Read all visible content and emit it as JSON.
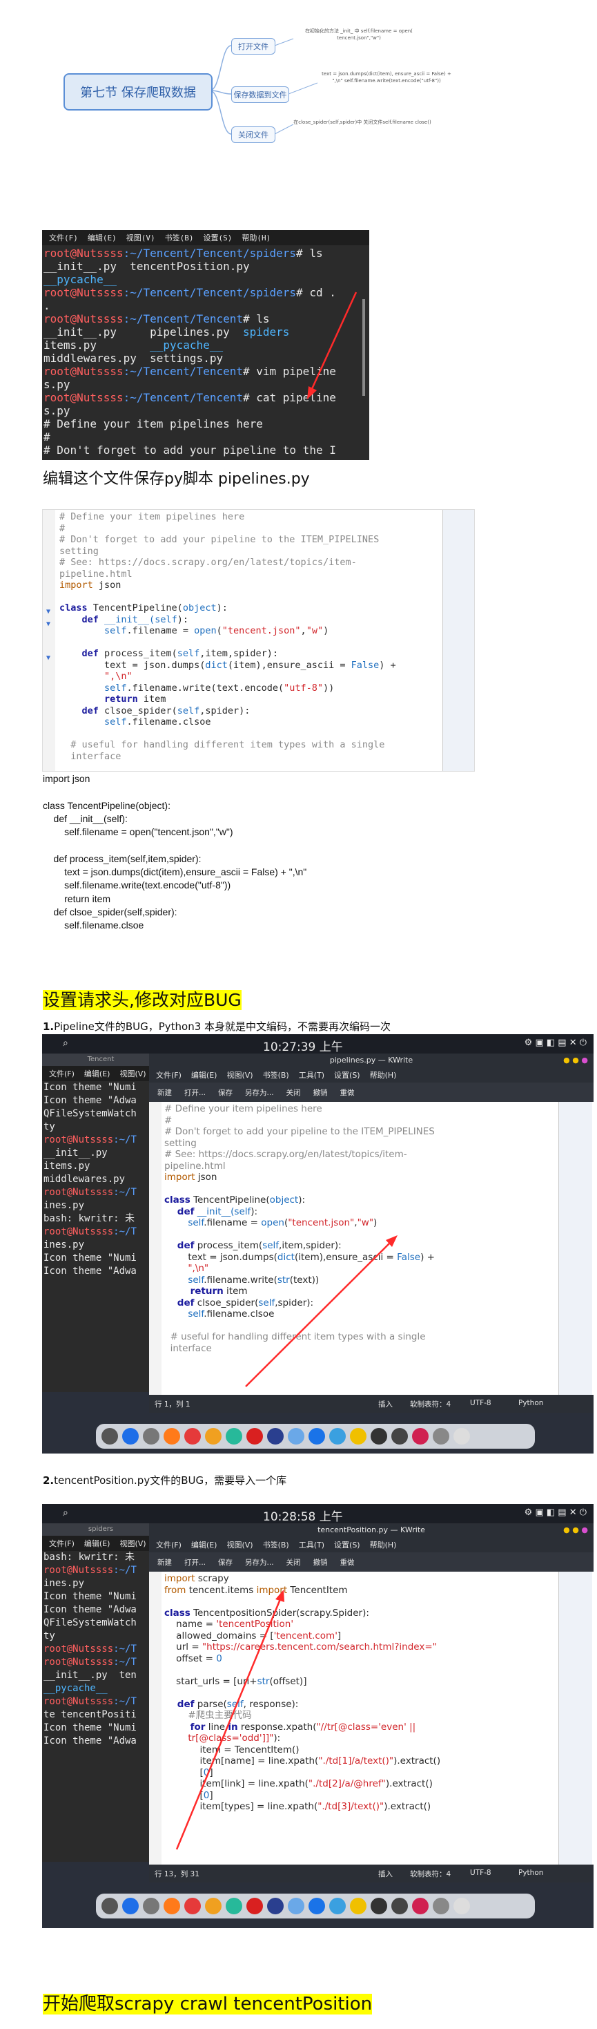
{
  "mindmap": {
    "root": "第七节 保存爬取数据",
    "branches": [
      {
        "label": "打开文件",
        "note": "在初始化的方法 _init_ 中 self.filename = open( tencent.json\",\"w\")"
      },
      {
        "label": "保存数据到文件",
        "note": "text = json.dumps(dict(item), ensure_ascii = False) + \",\\n\" self.filename.write(text.encode(\"utf-8\"))"
      },
      {
        "label": "关闭文件",
        "note": "在close_spider(self,spider)中 关闭文件self.filename close()"
      }
    ]
  },
  "terminal1": {
    "menu": [
      "文件(F)",
      "编辑(E)",
      "视图(V)",
      "书签(B)",
      "设置(S)",
      "帮助(H)"
    ],
    "lines": [
      [
        {
          "t": "root@Nutssss",
          "c": "red"
        },
        {
          "t": ":~/Tencent/Tencent/spiders",
          "c": "blue"
        },
        {
          "t": "# ls",
          "c": "white"
        }
      ],
      [
        {
          "t": "__init__.py  tencentPosition.py",
          "c": "white"
        }
      ],
      [
        {
          "t": "__pycache__",
          "c": "cyan"
        }
      ],
      [
        {
          "t": "root@Nutssss",
          "c": "red"
        },
        {
          "t": ":~/Tencent/Tencent/spiders",
          "c": "blue"
        },
        {
          "t": "# cd .",
          "c": "white"
        }
      ],
      [
        {
          "t": ".",
          "c": "white"
        }
      ],
      [
        {
          "t": "root@Nutssss",
          "c": "red"
        },
        {
          "t": ":~/Tencent/Tencent",
          "c": "blue"
        },
        {
          "t": "# ls",
          "c": "white"
        }
      ],
      [
        {
          "t": "__init__.py     pipelines.py  ",
          "c": "white"
        },
        {
          "t": "spiders",
          "c": "cyan"
        }
      ],
      [
        {
          "t": "items.py        ",
          "c": "white"
        },
        {
          "t": "__pycache__",
          "c": "cyan"
        }
      ],
      [
        {
          "t": "middlewares.py  settings.py",
          "c": "white"
        }
      ],
      [
        {
          "t": "root@Nutssss",
          "c": "red"
        },
        {
          "t": ":~/Tencent/Tencent",
          "c": "blue"
        },
        {
          "t": "# vim pipeline",
          "c": "white"
        }
      ],
      [
        {
          "t": "s.py",
          "c": "white"
        }
      ],
      [
        {
          "t": "root@Nutssss",
          "c": "red"
        },
        {
          "t": ":~/Tencent/Tencent",
          "c": "blue"
        },
        {
          "t": "# cat pipeline",
          "c": "white"
        }
      ],
      [
        {
          "t": "s.py",
          "c": "white"
        }
      ],
      [
        {
          "t": "# Define your item pipelines here",
          "c": "white"
        }
      ],
      [
        {
          "t": "#",
          "c": "white"
        }
      ],
      [
        {
          "t": "# Don't forget to add your pipeline to the I",
          "c": "white"
        }
      ]
    ]
  },
  "caption1": "编辑这个文件保存py脚本  pipelines.py",
  "code1": [
    [
      {
        "t": "# Define your item pipelines here",
        "c": "cm"
      }
    ],
    [
      {
        "t": "#",
        "c": "cm"
      }
    ],
    [
      {
        "t": "# Don't forget to add your pipeline to the ITEM_PIPELINES",
        "c": "cm"
      }
    ],
    [
      {
        "t": "setting",
        "c": "cm"
      }
    ],
    [
      {
        "t": "# See: https://docs.scrapy.org/en/latest/topics/item-",
        "c": "cm"
      }
    ],
    [
      {
        "t": "pipeline.html",
        "c": "cm"
      }
    ],
    [
      {
        "t": "import",
        "c": "imp"
      },
      {
        "t": " json",
        "c": "fn"
      }
    ],
    [
      {
        "t": "",
        "c": "fn"
      }
    ],
    [
      {
        "t": "class",
        "c": "k"
      },
      {
        "t": " TencentPipeline(",
        "c": "fn"
      },
      {
        "t": "object",
        "c": "b"
      },
      {
        "t": "):",
        "c": "fn"
      }
    ],
    [
      {
        "t": "    def",
        "c": "k"
      },
      {
        "t": " __init__(",
        "c": "b"
      },
      {
        "t": "self",
        "c": "b"
      },
      {
        "t": "):",
        "c": "fn"
      }
    ],
    [
      {
        "t": "        self",
        "c": "b"
      },
      {
        "t": ".filename = ",
        "c": "fn"
      },
      {
        "t": "open",
        "c": "b"
      },
      {
        "t": "(",
        "c": "fn"
      },
      {
        "t": "\"tencent.json\"",
        "c": "s"
      },
      {
        "t": ",",
        "c": "fn"
      },
      {
        "t": "\"w\"",
        "c": "s"
      },
      {
        "t": ")",
        "c": "fn"
      }
    ],
    [
      {
        "t": "",
        "c": "fn"
      }
    ],
    [
      {
        "t": "    def",
        "c": "k"
      },
      {
        "t": " process_item(",
        "c": "fn"
      },
      {
        "t": "self",
        "c": "b"
      },
      {
        "t": ",item,spider):",
        "c": "fn"
      }
    ],
    [
      {
        "t": "        text = json.dumps(",
        "c": "fn"
      },
      {
        "t": "dict",
        "c": "b"
      },
      {
        "t": "(item),ensure_ascii = ",
        "c": "fn"
      },
      {
        "t": "False",
        "c": "b"
      },
      {
        "t": ") +",
        "c": "fn"
      }
    ],
    [
      {
        "t": "        \",\\n\"",
        "c": "s"
      }
    ],
    [
      {
        "t": "        self",
        "c": "b"
      },
      {
        "t": ".filename.write(text.encode(",
        "c": "fn"
      },
      {
        "t": "\"utf-8\"",
        "c": "s"
      },
      {
        "t": "))",
        "c": "fn"
      }
    ],
    [
      {
        "t": "        return",
        "c": "k"
      },
      {
        "t": " item",
        "c": "fn"
      }
    ],
    [
      {
        "t": "    def",
        "c": "k"
      },
      {
        "t": " clsoe_spider(",
        "c": "fn"
      },
      {
        "t": "self",
        "c": "b"
      },
      {
        "t": ",spider):",
        "c": "fn"
      }
    ],
    [
      {
        "t": "        self",
        "c": "b"
      },
      {
        "t": ".filename.clsoe",
        "c": "fn"
      }
    ],
    [
      {
        "t": "",
        "c": "fn"
      }
    ],
    [
      {
        "t": "  # useful for handling different item types with a single",
        "c": "cm"
      }
    ],
    [
      {
        "t": "  interface",
        "c": "cm"
      }
    ]
  ],
  "plaincode": "import json\n\nclass TencentPipeline(object):\n    def __init__(self):\n        self.filename = open(\"tencent.json\",\"w\")\n\n    def process_item(self,item,spider):\n        text = json.dumps(dict(item),ensure_ascii = False) + \",\\n\"\n        self.filename.write(text.encode(\"utf-8\"))\n        return item\n    def clsoe_spider(self,spider):\n        self.filename.clsoe",
  "heading1": "设置请求头,修改对应BUG",
  "step1": {
    "num": "1.",
    "text": "Pipeline文件的BUG，Python3 本身就是中文编码，不需要再次编码一次"
  },
  "shot1": {
    "clock": "10:27:39 上午",
    "title": "pipelines.py — KWrite",
    "tab": "Tencent",
    "term_menu": [
      "文件(F)",
      "编辑(E)",
      "视图(V)"
    ],
    "kw_menu": [
      "文件(F)",
      "编辑(E)",
      "视图(V)",
      "书签(B)",
      "工具(T)",
      "设置(S)",
      "帮助(H)"
    ],
    "toolbar": [
      "新建",
      "打开...",
      "保存",
      "另存为...",
      "关闭",
      "撤销",
      "重做"
    ],
    "term_lines": [
      "Icon theme \"Numi",
      "Icon theme \"Adwa",
      "QFileSystemWatch",
      "ty",
      "root@Nutssss:~/T",
      "__init__.py",
      "items.py",
      "middlewares.py",
      "root@Nutssss:~/T",
      "ines.py",
      "bash: kwritr: 未",
      "root@Nutssss:~/T",
      "ines.py",
      "Icon theme \"Numi",
      "Icon theme \"Adwa"
    ],
    "status_pos": "行 1，列 1",
    "status_insert": "插入",
    "status_indent": "软制表符：4",
    "status_enc": "UTF-8",
    "status_lang": "Python"
  },
  "code2": [
    [
      {
        "t": "# Define your item pipelines here",
        "c": "cm"
      }
    ],
    [
      {
        "t": "#",
        "c": "cm"
      }
    ],
    [
      {
        "t": "# Don't forget to add your pipeline to the ITEM_PIPELINES",
        "c": "cm"
      }
    ],
    [
      {
        "t": "setting",
        "c": "cm"
      }
    ],
    [
      {
        "t": "# See: https://docs.scrapy.org/en/latest/topics/item-",
        "c": "cm"
      }
    ],
    [
      {
        "t": "pipeline.html",
        "c": "cm"
      }
    ],
    [
      {
        "t": "import",
        "c": "imp"
      },
      {
        "t": " json",
        "c": "fn"
      }
    ],
    [
      {
        "t": "",
        "c": "fn"
      }
    ],
    [
      {
        "t": "class",
        "c": "k"
      },
      {
        "t": " TencentPipeline(",
        "c": "fn"
      },
      {
        "t": "object",
        "c": "b"
      },
      {
        "t": "):",
        "c": "fn"
      }
    ],
    [
      {
        "t": "    def",
        "c": "k"
      },
      {
        "t": " __init__(",
        "c": "b"
      },
      {
        "t": "self",
        "c": "b"
      },
      {
        "t": "):",
        "c": "fn"
      }
    ],
    [
      {
        "t": "        self",
        "c": "b"
      },
      {
        "t": ".filename = ",
        "c": "fn"
      },
      {
        "t": "open",
        "c": "b"
      },
      {
        "t": "(",
        "c": "fn"
      },
      {
        "t": "\"tencent.json\"",
        "c": "s"
      },
      {
        "t": ",",
        "c": "fn"
      },
      {
        "t": "\"w\"",
        "c": "s"
      },
      {
        "t": ")",
        "c": "fn"
      }
    ],
    [
      {
        "t": "",
        "c": "fn"
      }
    ],
    [
      {
        "t": "    def",
        "c": "k"
      },
      {
        "t": " process_item(",
        "c": "fn"
      },
      {
        "t": "self",
        "c": "b"
      },
      {
        "t": ",item,spider):",
        "c": "fn"
      }
    ],
    [
      {
        "t": "        text = json.dumps(",
        "c": "fn"
      },
      {
        "t": "dict",
        "c": "b"
      },
      {
        "t": "(item),ensure_ascii = ",
        "c": "fn"
      },
      {
        "t": "False",
        "c": "b"
      },
      {
        "t": ") +",
        "c": "fn"
      }
    ],
    [
      {
        "t": "        \",\\n\"",
        "c": "s"
      }
    ],
    [
      {
        "t": "        self",
        "c": "b"
      },
      {
        "t": ".filename.write(",
        "c": "fn"
      },
      {
        "t": "str",
        "c": "b"
      },
      {
        "t": "(text))",
        "c": "fn"
      }
    ],
    [
      {
        "t": "        return",
        "c": "k"
      },
      {
        "t": " item",
        "c": "fn"
      }
    ],
    [
      {
        "t": "    def",
        "c": "k"
      },
      {
        "t": " clsoe_spider(",
        "c": "fn"
      },
      {
        "t": "self",
        "c": "b"
      },
      {
        "t": ",spider):",
        "c": "fn"
      }
    ],
    [
      {
        "t": "        self",
        "c": "b"
      },
      {
        "t": ".filename.clsoe",
        "c": "fn"
      }
    ],
    [
      {
        "t": "",
        "c": "fn"
      }
    ],
    [
      {
        "t": "  # useful for handling different item types with a single",
        "c": "cm"
      }
    ],
    [
      {
        "t": "  interface",
        "c": "cm"
      }
    ]
  ],
  "step2": {
    "num": "2.",
    "text": "tencentPosition.py文件的BUG，需要导入一个库"
  },
  "shot2": {
    "clock": "10:28:58 上午",
    "title": "tencentPosition.py — KWrite",
    "tab": "spiders",
    "term_menu": [
      "文件(F)",
      "编辑(E)",
      "视图(V)"
    ],
    "kw_menu": [
      "文件(F)",
      "编辑(E)",
      "视图(V)",
      "书签(B)",
      "工具(T)",
      "设置(S)",
      "帮助(H)"
    ],
    "toolbar": [
      "新建",
      "打开...",
      "保存",
      "另存为...",
      "关闭",
      "撤销",
      "重做"
    ],
    "term_lines": [
      "bash: kwritr: 未",
      "root@Nutssss:~/T",
      "ines.py",
      "Icon theme \"Numi",
      "Icon theme \"Adwa",
      "QFileSystemWatch",
      "ty",
      "root@Nutssss:~/T",
      "root@Nutssss:~/T",
      "__init__.py  ten",
      "__pycache__",
      "root@Nutssss:~/T",
      "te tencentPositi",
      "Icon theme \"Numi",
      "Icon theme \"Adwa"
    ],
    "status_pos": "行 13，列 31",
    "status_insert": "插入",
    "status_indent": "软制表符：4",
    "status_enc": "UTF-8",
    "status_lang": "Python"
  },
  "code3": [
    [
      {
        "t": "import",
        "c": "imp"
      },
      {
        "t": " scrapy",
        "c": "fn"
      }
    ],
    [
      {
        "t": "from",
        "c": "imp"
      },
      {
        "t": " tencent.items ",
        "c": "fn"
      },
      {
        "t": "import",
        "c": "imp"
      },
      {
        "t": " TencentItem",
        "c": "fn"
      }
    ],
    [
      {
        "t": "",
        "c": "fn"
      }
    ],
    [
      {
        "t": "class",
        "c": "k"
      },
      {
        "t": " TencentpositionSpider(scrapy.Spider):",
        "c": "fn"
      }
    ],
    [
      {
        "t": "    name = ",
        "c": "fn"
      },
      {
        "t": "'tencentPosition'",
        "c": "s"
      }
    ],
    [
      {
        "t": "    allowed_domains = [",
        "c": "fn"
      },
      {
        "t": "'tencent.com'",
        "c": "s"
      },
      {
        "t": "]",
        "c": "fn"
      }
    ],
    [
      {
        "t": "    url = ",
        "c": "fn"
      },
      {
        "t": "\"https://careers.tencent.com/search.html?index=\"",
        "c": "s"
      }
    ],
    [
      {
        "t": "    offset = ",
        "c": "fn"
      },
      {
        "t": "0",
        "c": "b"
      }
    ],
    [
      {
        "t": "",
        "c": "fn"
      }
    ],
    [
      {
        "t": "    start_urls = [url+",
        "c": "fn"
      },
      {
        "t": "str",
        "c": "b"
      },
      {
        "t": "(offset)]",
        "c": "fn"
      }
    ],
    [
      {
        "t": "",
        "c": "fn"
      }
    ],
    [
      {
        "t": "    def",
        "c": "k"
      },
      {
        "t": " parse(",
        "c": "fn"
      },
      {
        "t": "self",
        "c": "b"
      },
      {
        "t": ", response):",
        "c": "fn"
      }
    ],
    [
      {
        "t": "        #爬虫主要代码",
        "c": "cm"
      }
    ],
    [
      {
        "t": "        for",
        "c": "k"
      },
      {
        "t": " line ",
        "c": "fn"
      },
      {
        "t": "in",
        "c": "k"
      },
      {
        "t": " response.xpath(",
        "c": "fn"
      },
      {
        "t": "\"//tr[@class='even' ||",
        "c": "s"
      }
    ],
    [
      {
        "t": "        tr[@class='odd']]\"",
        "c": "s"
      },
      {
        "t": "):",
        "c": "fn"
      }
    ],
    [
      {
        "t": "            item = TencentItem()",
        "c": "fn"
      }
    ],
    [
      {
        "t": "            item[name] = line.xpath(",
        "c": "fn"
      },
      {
        "t": "\"./td[1]/a/text()\"",
        "c": "s"
      },
      {
        "t": ").extract()",
        "c": "fn"
      }
    ],
    [
      {
        "t": "            [",
        "c": "fn"
      },
      {
        "t": "0",
        "c": "b"
      },
      {
        "t": "]",
        "c": "fn"
      }
    ],
    [
      {
        "t": "            item[link] = line.xpath(",
        "c": "fn"
      },
      {
        "t": "\"./td[2]/a/@href\"",
        "c": "s"
      },
      {
        "t": ").extract()",
        "c": "fn"
      }
    ],
    [
      {
        "t": "            [",
        "c": "fn"
      },
      {
        "t": "0",
        "c": "b"
      },
      {
        "t": "]",
        "c": "fn"
      }
    ],
    [
      {
        "t": "            item[types] = line.xpath(",
        "c": "fn"
      },
      {
        "t": "\"./td[3]/text()\"",
        "c": "s"
      },
      {
        "t": ").extract()",
        "c": "fn"
      }
    ]
  ],
  "heading2": "开始爬取scrapy crawl tencentPosition"
}
